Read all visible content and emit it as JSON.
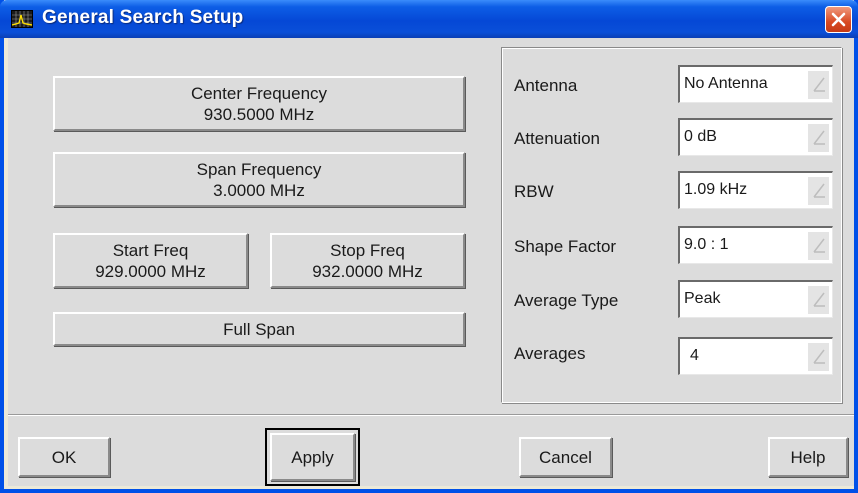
{
  "window": {
    "title": "General Search Setup"
  },
  "left": {
    "center": {
      "label": "Center Frequency",
      "value": "930.5000 MHz"
    },
    "span": {
      "label": "Span Frequency",
      "value": "3.0000 MHz"
    },
    "start": {
      "label": "Start Freq",
      "value": "929.0000 MHz"
    },
    "stop": {
      "label": "Stop Freq",
      "value": "932.0000 MHz"
    },
    "full_span": "Full Span"
  },
  "settings": [
    {
      "label": "Antenna",
      "value": "No Antenna"
    },
    {
      "label": "Attenuation",
      "value": "0 dB"
    },
    {
      "label": "RBW",
      "value": "1.09 kHz"
    },
    {
      "label": "Shape Factor",
      "value": "9.0 : 1"
    },
    {
      "label": "Average Type",
      "value": "Peak"
    },
    {
      "label": "Averages",
      "value": "4"
    }
  ],
  "footer": {
    "ok": "OK",
    "apply": "Apply",
    "cancel": "Cancel",
    "help": "Help"
  },
  "icons": {
    "app": "spectrum-grid-icon",
    "close": "close-icon",
    "dropdown": "dropdown-arrow-icon"
  },
  "colors": {
    "title_bar": "#0548d6",
    "close_button": "#d84a22",
    "dialog_bg": "#dcdcdc"
  }
}
